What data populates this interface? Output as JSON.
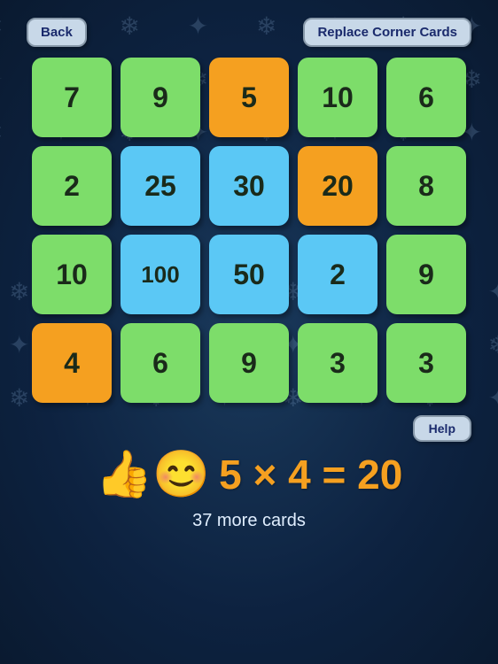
{
  "header": {
    "back_label": "Back",
    "replace_label": "Replace Corner Cards"
  },
  "grid": {
    "rows": [
      [
        {
          "value": "7",
          "color": "green"
        },
        {
          "value": "9",
          "color": "green"
        },
        {
          "value": "5",
          "color": "orange"
        },
        {
          "value": "10",
          "color": "green"
        },
        {
          "value": "6",
          "color": "green"
        }
      ],
      [
        {
          "value": "2",
          "color": "green"
        },
        {
          "value": "25",
          "color": "blue"
        },
        {
          "value": "30",
          "color": "blue"
        },
        {
          "value": "20",
          "color": "orange"
        },
        {
          "value": "8",
          "color": "green"
        }
      ],
      [
        {
          "value": "10",
          "color": "green"
        },
        {
          "value": "100",
          "color": "blue"
        },
        {
          "value": "50",
          "color": "blue"
        },
        {
          "value": "2",
          "color": "blue"
        },
        {
          "value": "9",
          "color": "green"
        }
      ],
      [
        {
          "value": "4",
          "color": "orange"
        },
        {
          "value": "6",
          "color": "green"
        },
        {
          "value": "9",
          "color": "green"
        },
        {
          "value": "3",
          "color": "green"
        },
        {
          "value": "3",
          "color": "green"
        }
      ]
    ]
  },
  "help": {
    "label": "Help"
  },
  "equation": {
    "text": "5 × 4 = 20",
    "emoji": "👍😊"
  },
  "footer": {
    "more_cards": "37 more cards"
  }
}
